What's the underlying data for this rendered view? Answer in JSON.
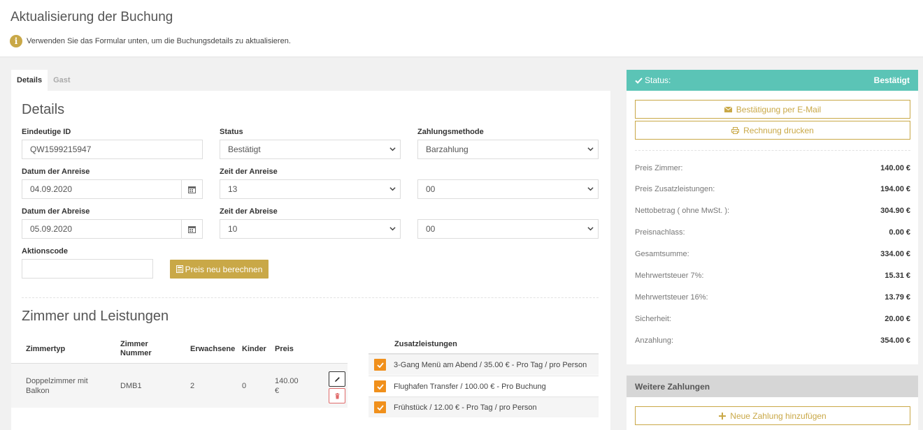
{
  "header": {
    "title": "Aktualisierung der Buchung",
    "info": "Verwenden Sie das Formular unten, um die Buchungsdetails zu aktualisieren."
  },
  "tabs": [
    {
      "label": "Details",
      "active": true
    },
    {
      "label": "Gast",
      "active": false
    }
  ],
  "details": {
    "title": "Details",
    "id_label": "Eindeutige ID",
    "id_value": "QW1599215947",
    "status_label": "Status",
    "status_value": "Bestätigt",
    "payment_label": "Zahlungsmethode",
    "payment_value": "Barzahlung",
    "arrival_date_label": "Datum der Anreise",
    "arrival_date_value": "04.09.2020",
    "arrival_time_label": "Zeit der Anreise",
    "arrival_hour": "13",
    "arrival_minute": "00",
    "departure_date_label": "Datum der Abreise",
    "departure_date_value": "05.09.2020",
    "departure_time_label": "Zeit der Abreise",
    "departure_hour": "10",
    "departure_minute": "00",
    "promo_label": "Aktionscode",
    "promo_value": "",
    "recalc_label": "Preis neu berechnen"
  },
  "rooms": {
    "title": "Zimmer und Leistungen",
    "headers": {
      "type": "Zimmertyp",
      "number_line1": "Zimmer",
      "number_line2": "Nummer",
      "adults": "Erwachsene",
      "children": "Kinder",
      "price": "Preis"
    },
    "row": {
      "type_line1": "Doppelzimmer mit",
      "type_line2": "Balkon",
      "number": "DMB1",
      "adults": "2",
      "children": "0",
      "price_line1": "140.00",
      "price_line2": "€"
    },
    "extras_header": "Zusatzleistungen",
    "extras": [
      {
        "label": "3-Gang Menü am Abend / 35.00 € - Pro Tag / pro Person",
        "checked": true
      },
      {
        "label": "Flughafen Transfer / 100.00 € - Pro Buchung",
        "checked": true
      },
      {
        "label": "Frühstück / 12.00 € - Pro Tag / pro Person",
        "checked": true
      }
    ]
  },
  "status": {
    "label": "Status:",
    "value": "Bestätigt",
    "email_button": "Bestätigung per E-Mail",
    "print_button": "Rechnung drucken",
    "prices": [
      {
        "label": "Preis Zimmer:",
        "value": "140.00 €"
      },
      {
        "label": "Preis Zusatzleistungen:",
        "value": "194.00 €"
      },
      {
        "label": "Nettobetrag ( ohne MwSt. ):",
        "value": "304.90 €"
      },
      {
        "label": "Preisnachlass:",
        "value": "0.00 €"
      },
      {
        "label": "Gesamtsumme:",
        "value": "334.00 €"
      },
      {
        "label": "Mehrwertsteuer 7%:",
        "value": "15.31 €"
      },
      {
        "label": "Mehrwertsteuer 16%:",
        "value": "13.79 €"
      },
      {
        "label": "Sicherheit:",
        "value": "20.00 €"
      },
      {
        "label": "Anzahlung:",
        "value": "354.00 €"
      }
    ]
  },
  "payments": {
    "title": "Weitere Zahlungen",
    "add_button": "Neue Zahlung hinzufügen"
  },
  "colors": {
    "accent_gold": "#c9a847",
    "status_teal": "#5bc4b6",
    "checkbox_orange": "#f0901c"
  }
}
